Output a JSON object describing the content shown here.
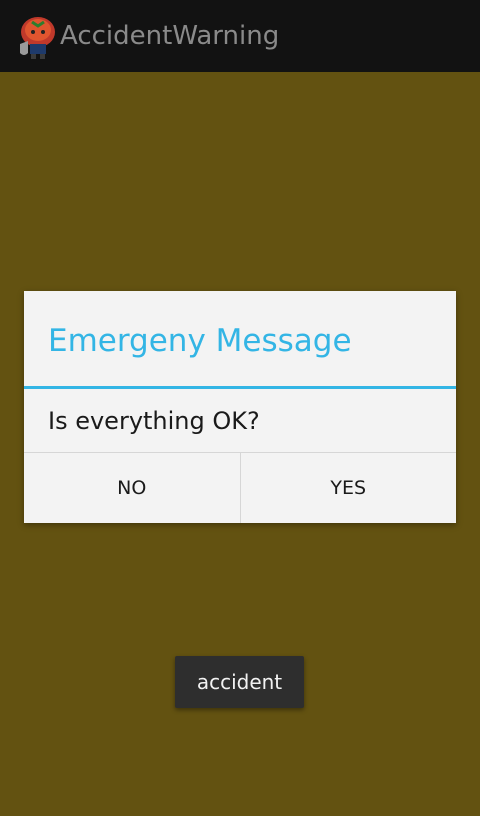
{
  "action_bar": {
    "icon": "tomato-mascot-icon",
    "title": "AccidentWarning"
  },
  "dialog": {
    "title": "Emergeny Message",
    "message": "Is everything OK?",
    "buttons": {
      "negative": "NO",
      "positive": "YES"
    }
  },
  "toast": {
    "text": "accident"
  },
  "colors": {
    "background": "#635211",
    "accent": "#33b5e5",
    "action_bar": "#121212"
  }
}
